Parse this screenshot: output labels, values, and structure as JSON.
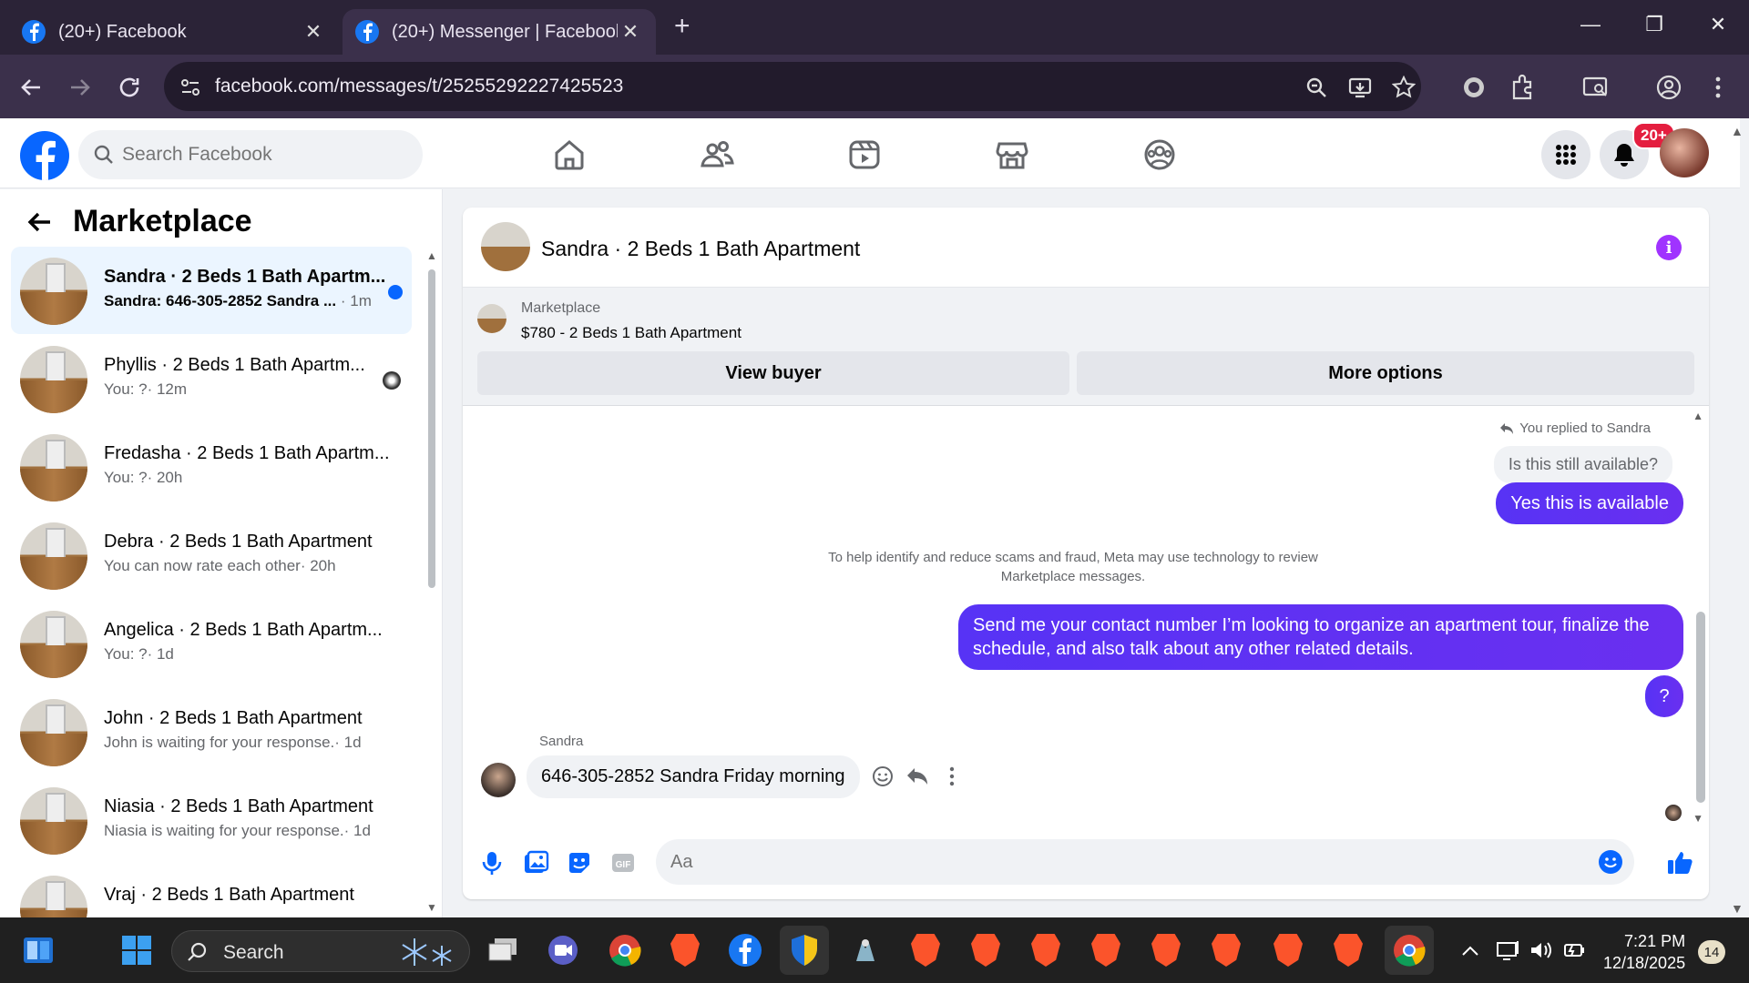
{
  "browser": {
    "tabs": [
      {
        "title": "(20+) Facebook",
        "active": false
      },
      {
        "title": "(20+) Messenger | Facebook",
        "active": true
      }
    ],
    "url": "facebook.com/messages/t/25255292227425523"
  },
  "facebook": {
    "search_placeholder": "Search Facebook",
    "notification_badge": "20+",
    "nav_icons": [
      "home-icon",
      "friends-icon",
      "video-icon",
      "marketplace-icon",
      "groups-icon"
    ]
  },
  "sidebar": {
    "title": "Marketplace",
    "conversations": [
      {
        "name": "Sandra · 2 Beds 1 Bath Apartm...",
        "preview": "Sandra: 646-305-2852 Sandra ...",
        "time": "· 1m",
        "unread": true
      },
      {
        "name": "Phyllis · 2 Beds 1 Bath Apartm...",
        "preview": "You: ?",
        "time": "· 12m"
      },
      {
        "name": "Fredasha · 2 Beds 1 Bath Apartm...",
        "preview": "You: ?",
        "time": "· 20h"
      },
      {
        "name": "Debra · 2 Beds 1 Bath Apartment",
        "preview": "You can now rate each other",
        "time": "· 20h"
      },
      {
        "name": "Angelica · 2 Beds 1 Bath Apartm...",
        "preview": "You: ?",
        "time": "· 1d"
      },
      {
        "name": "John · 2 Beds 1 Bath Apartment",
        "preview": "John is waiting for your response.",
        "time": "· 1d"
      },
      {
        "name": "Niasia · 2 Beds 1 Bath Apartment",
        "preview": "Niasia is waiting for your response.",
        "time": "· 1d"
      },
      {
        "name": "Vraj · 2 Beds 1 Bath Apartment",
        "preview": "",
        "time": ""
      }
    ]
  },
  "chat": {
    "title": "Sandra · 2 Beds 1 Bath Apartment",
    "listing": {
      "source": "Marketplace",
      "item": "$780 - 2 Beds 1 Bath Apartment",
      "view_buyer": "View buyer",
      "more_options": "More options"
    },
    "reply_meta": "You replied to Sandra",
    "quoted": "Is this still available?",
    "msg_available": "Yes this is available",
    "notice": "To help identify and reduce scams and fraud, Meta may use technology to review Marketplace messages.",
    "msg_contact": "Send me your contact number I’m looking to organize an apartment tour, finalize the schedule, and also talk about any other related details.",
    "msg_question": "?",
    "sender": "Sandra",
    "msg_in": "646-305-2852 Sandra Friday morning",
    "composer_placeholder": "Aa"
  },
  "taskbar": {
    "search_label": "Search",
    "time": "7:21 PM",
    "date": "12/18/2025",
    "notifications": "14"
  }
}
